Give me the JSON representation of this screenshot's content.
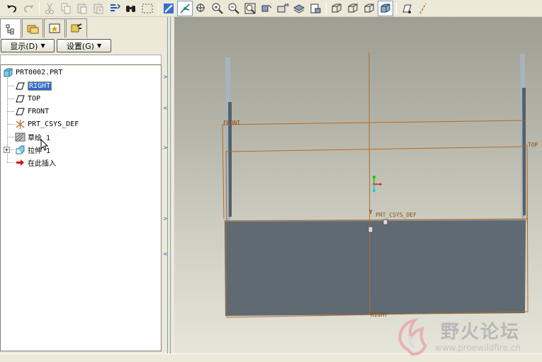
{
  "toolbar": {
    "buttons": [
      "undo-icon",
      "redo-icon",
      "cut-icon",
      "copy-icon",
      "paste-icon",
      "paste-special-icon",
      "regenerate-icon",
      "find-icon",
      "select-box-icon",
      "repaint-icon",
      "spin-center-icon",
      "orient-icon",
      "zoom-in-icon",
      "zoom-out-icon",
      "refit-icon",
      "reorient-icon",
      "saved-views-icon",
      "layers-icon",
      "view-manager-icon",
      "wireframe-icon",
      "hidden-line-icon",
      "no-hidden-icon",
      "shading-icon",
      "datum-planes-icon",
      "datum-axes-icon"
    ]
  },
  "leftpanel": {
    "tabs": [
      "model-tree-tab",
      "folder-browser-tab",
      "favorites-tab",
      "connections-tab"
    ],
    "show_menu": "显示(D)",
    "settings_menu": "设置(G)"
  },
  "tree": {
    "root": "PRT0002.PRT",
    "items": [
      {
        "label": "RIGHT",
        "icon": "datum-plane-icon",
        "selected": true
      },
      {
        "label": "TOP",
        "icon": "datum-plane-icon",
        "selected": false
      },
      {
        "label": "FRONT",
        "icon": "datum-plane-icon",
        "selected": false
      },
      {
        "label": "PRT_CSYS_DEF",
        "icon": "coordinate-system-icon",
        "selected": false
      },
      {
        "label": "草绘 1",
        "icon": "sketch-icon",
        "selected": false
      },
      {
        "label": "拉伸 1",
        "icon": "extrude-icon",
        "selected": false
      },
      {
        "label": "在此插入",
        "icon": "insert-here-arrow-icon",
        "selected": false
      }
    ]
  },
  "viewport": {
    "labels": {
      "front": "FRONT",
      "top": "TOP",
      "csys": "PRT_CSYS_DEF",
      "right": "RIGHT",
      "y": "Y"
    }
  },
  "watermark": {
    "title": "野火论坛",
    "url": "www.proewildfire.cn"
  },
  "colors": {
    "datum": "#b36b2a",
    "model_body": "#5f6a72",
    "selection": "#316ac5"
  }
}
